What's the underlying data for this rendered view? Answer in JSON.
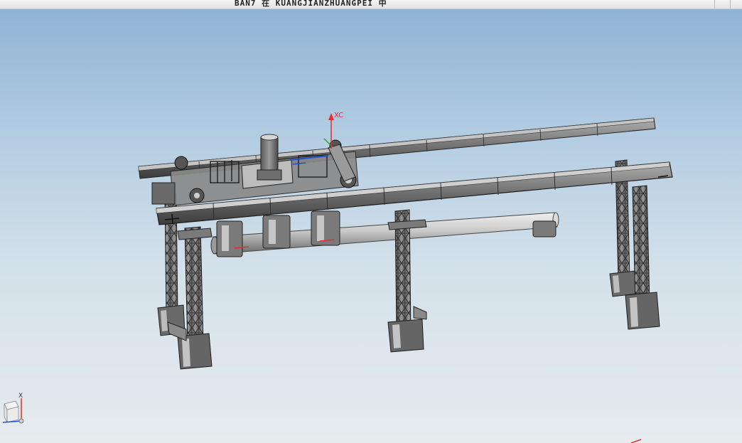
{
  "window": {
    "title": "BAN7 在 KUANGJIANZHUANGPEI 中"
  },
  "viewport": {
    "model_name": "gantry-assembly",
    "colors": {
      "background_top": "#8fb3d6",
      "background_bottom": "#e6ebee",
      "steel_dark": "#3a3a3a",
      "steel_mid": "#7a7a7a",
      "steel_light": "#a8a8a8",
      "axis_z": "#e03030",
      "axis_y": "#2ca02c",
      "axis_x": "#2050d0"
    },
    "wcs_label": "XC",
    "triad_label": "X"
  }
}
